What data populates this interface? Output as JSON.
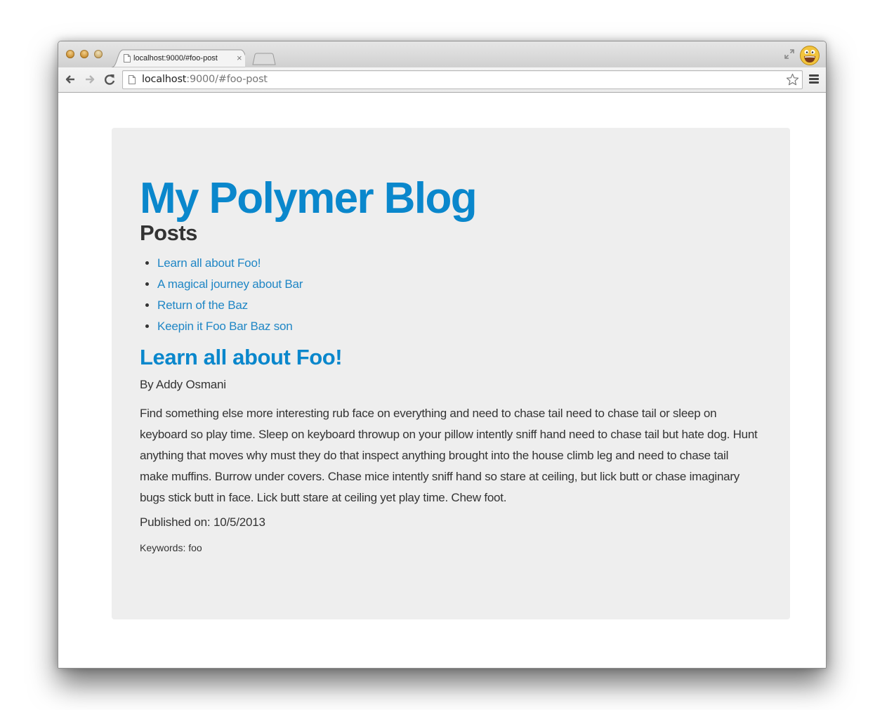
{
  "browser": {
    "tab": {
      "title": "localhost:9000/#foo-post",
      "icon": "page-icon",
      "close_glyph": "×"
    },
    "address_bar": {
      "host": "localhost",
      "rest": ":9000/#foo-post"
    },
    "icons": {
      "back": "arrow-left-icon",
      "forward": "arrow-right-icon",
      "reload": "reload-icon",
      "bookmark": "star-icon",
      "menu": "hamburger-menu-icon",
      "fullscreen": "fullscreen-icon",
      "profile": "avatar-icon"
    }
  },
  "page": {
    "blog_title": "My Polymer Blog",
    "posts_heading": "Posts",
    "posts": [
      {
        "label": "Learn all about Foo!"
      },
      {
        "label": "A magical journey about Bar"
      },
      {
        "label": "Return of the Baz"
      },
      {
        "label": "Keepin it Foo Bar Baz son"
      }
    ],
    "post": {
      "title": "Learn all about Foo!",
      "byline": "By Addy Osmani",
      "body": "Find something else more interesting rub face on everything and need to chase tail need to chase tail or sleep on keyboard so play time. Sleep on keyboard throwup on your pillow intently sniff hand need to chase tail but hate dog. Hunt anything that moves why must they do that inspect anything brought into the house climb leg and need to chase tail make muffins. Burrow under covers. Chase mice intently sniff hand so stare at ceiling, but lick butt or chase imaginary bugs stick butt in face. Lick butt stare at ceiling yet play time. Chew foot.",
      "published": "Published on: 10/5/2013",
      "keywords": "Keywords: foo"
    }
  },
  "colors": {
    "accent": "#0a87cc",
    "link": "#1f86c5",
    "panel_background": "#eeeeee",
    "text": "#333333"
  }
}
